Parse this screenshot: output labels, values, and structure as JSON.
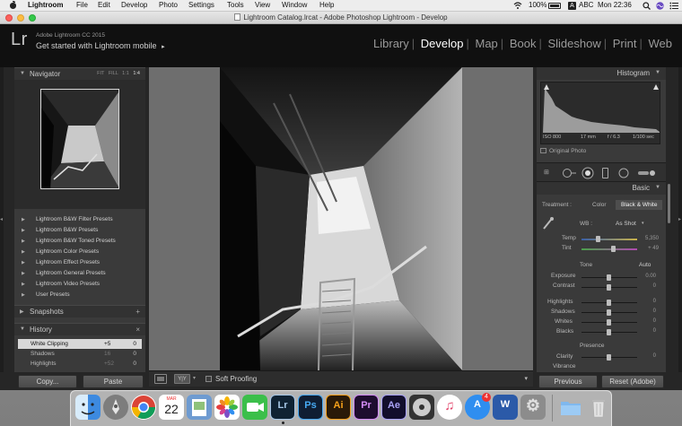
{
  "menubar": {
    "app_name": "Lightroom",
    "items": [
      "File",
      "Edit",
      "Develop",
      "Photo",
      "Settings",
      "Tools",
      "View",
      "Window",
      "Help"
    ],
    "battery": "100%",
    "input_source": "ABC",
    "clock": "Mon 22:36"
  },
  "window": {
    "title": "Lightroom Catalog.lrcat - Adobe Photoshop Lightroom - Develop"
  },
  "identity": {
    "logo": "Lr",
    "product": "Adobe Lightroom CC 2015",
    "get_started": "Get started with Lightroom mobile",
    "get_started_arrow": "▸"
  },
  "modules": {
    "items": [
      "Library",
      "Develop",
      "Map",
      "Book",
      "Slideshow",
      "Print",
      "Web"
    ],
    "active": "Develop"
  },
  "navigator": {
    "label": "Navigator",
    "options": [
      "FIT",
      "FILL",
      "1:1",
      "1:4"
    ]
  },
  "presets": [
    "Lightroom B&W Filter Presets",
    "Lightroom B&W Presets",
    "Lightroom B&W Toned Presets",
    "Lightroom Color Presets",
    "Lightroom Effect Presets",
    "Lightroom General Presets",
    "Lightroom Video Presets",
    "User Presets"
  ],
  "snapshots": {
    "label": "Snapshots",
    "action": "+"
  },
  "history": {
    "label": "History",
    "action": "×",
    "rows": [
      {
        "name": "White Clipping",
        "a": "+5",
        "b": "0",
        "selected": true
      },
      {
        "name": "Shadows",
        "a": "16",
        "b": "0",
        "selected": false
      },
      {
        "name": "Highlights",
        "a": "+52",
        "b": "0",
        "selected": false
      }
    ]
  },
  "left_buttons": {
    "copy": "Copy...",
    "paste": "Paste"
  },
  "toolbar": {
    "soft_proofing": "Soft Proofing",
    "view_mode": "Y|Y"
  },
  "histogram": {
    "label": "Histogram",
    "iso": "ISO 800",
    "focal": "17 mm",
    "aperture": "f / 6.3",
    "shutter": "1/100 sec",
    "original_photo": "Original Photo"
  },
  "basic": {
    "label": "Basic",
    "treatment_label": "Treatment :",
    "treatment_color": "Color",
    "treatment_bw": "Black & White",
    "wb_label": "WB :",
    "wb_value": "As Shot",
    "temp_label": "Temp",
    "temp_value": "5,350",
    "tint_label": "Tint",
    "tint_value": "+ 49",
    "tone_label": "Tone",
    "auto_label": "Auto",
    "sliders": [
      {
        "label": "Exposure",
        "value": "0.00"
      },
      {
        "label": "Contrast",
        "value": "0"
      },
      {
        "label": "Highlights",
        "value": "0"
      },
      {
        "label": "Shadows",
        "value": "0"
      },
      {
        "label": "Whites",
        "value": "0"
      },
      {
        "label": "Blacks",
        "value": "0"
      }
    ],
    "presence_label": "Presence",
    "clarity_label": "Clarity",
    "clarity_value": "0",
    "vibrance_label": "Vibrance"
  },
  "right_buttons": {
    "previous": "Previous",
    "reset": "Reset (Adobe)"
  },
  "dock": {
    "calendar_month": "MAR",
    "calendar_day": "22",
    "apps": [
      {
        "name": "finder",
        "glyph": "",
        "color": "#3d8ae0"
      },
      {
        "name": "launchpad",
        "glyph": "",
        "color": "#7d7d7d"
      },
      {
        "name": "chrome",
        "glyph": "",
        "color": "#ffffff"
      },
      {
        "name": "calendar",
        "glyph": "",
        "color": "#ffffff"
      },
      {
        "name": "preview",
        "glyph": "",
        "color": "#6e9bd1"
      },
      {
        "name": "photos",
        "glyph": "",
        "color": "#ffffff"
      },
      {
        "name": "facetime",
        "glyph": "",
        "color": "#3bbf4a"
      },
      {
        "name": "lightroom",
        "glyph": "Lr",
        "color": "#0f2233",
        "fg": "#a7c8e8"
      },
      {
        "name": "photoshop",
        "glyph": "Ps",
        "color": "#0f1e33",
        "fg": "#46a9f2"
      },
      {
        "name": "illustrator",
        "glyph": "Ai",
        "color": "#2a1a08",
        "fg": "#f7a21b"
      },
      {
        "name": "premiere",
        "glyph": "Pr",
        "color": "#1e0d2f",
        "fg": "#d48cf5"
      },
      {
        "name": "after-effects",
        "glyph": "Ae",
        "color": "#120e2c",
        "fg": "#a9a2f5"
      },
      {
        "name": "dvd-player",
        "glyph": "",
        "color": "#333333"
      },
      {
        "name": "itunes",
        "glyph": "♫",
        "color": "#ffffff",
        "fg": "#e2466c"
      },
      {
        "name": "app-store",
        "glyph": "A",
        "color": "#2f8ef0",
        "fg": "#ffffff"
      },
      {
        "name": "word",
        "glyph": "W",
        "color": "#2b5aa8",
        "fg": "#ffffff"
      },
      {
        "name": "system-preferences",
        "glyph": "⚙",
        "color": "#8c8c8c",
        "fg": "#e0e0e0"
      },
      {
        "name": "folder",
        "glyph": "",
        "color": "#7fb8ee"
      },
      {
        "name": "trash",
        "glyph": "",
        "color": "#d4d4d4"
      }
    ],
    "app_store_badge": "4"
  }
}
